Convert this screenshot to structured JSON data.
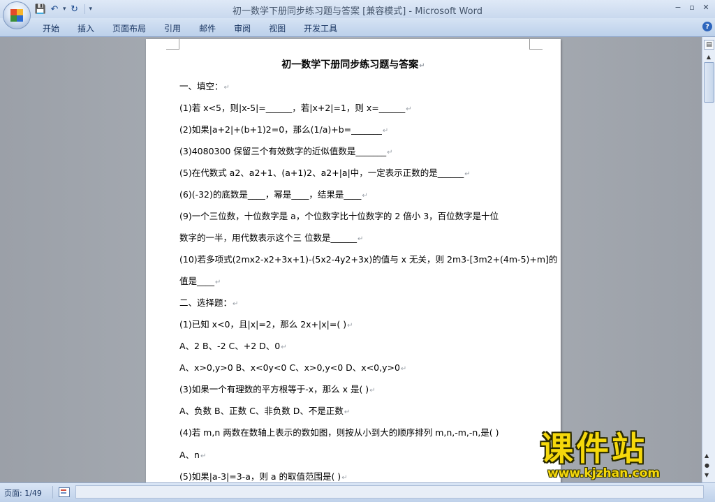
{
  "window": {
    "title": "初一数学下册同步练习题与答案 [兼容模式] - Microsoft Word",
    "controls": [
      "−",
      "▫",
      "✕"
    ]
  },
  "ribbon": {
    "tabs": [
      "开始",
      "插入",
      "页面布局",
      "引用",
      "邮件",
      "审阅",
      "视图",
      "开发工具"
    ]
  },
  "document": {
    "title": "初一数学下册同步练习题与答案",
    "lines": [
      "一、填空：",
      "(1)若 x<5，则|x-5|=______，若|x+2|=1，则 x=______",
      "(2)如果|a+2|+(b+1)2=0，那么(1/a)+b=_______",
      "(3)4080300 保留三个有效数字的近似值数是_______",
      "(5)在代数式 a2、a2+1、(a+1)2、a2+|a|中，一定表示正数的是______",
      "(6)(-32)的底数是____，幂是____，结果是____",
      "(9)一个三位数，十位数字是 a，个位数字比十位数字的 2 倍小 3，百位数字是十位",
      "数字的一半，用代数表示这个三          位数是______",
      "(10)若多项式(2mx2-x2+3x+1)-(5x2-4y2+3x)的值与 x 无关，则 2m3-[3m2+(4m-5)+m]的",
      "值是____",
      "二、选择题：",
      "(1)已知 x<0，且|x|=2，那么 2x+|x|=(        )",
      "A、2      B、-2      C、+2      D、0",
      "A、x>0,y>0      B、x<0y<0      C、x>0,y<0      D、x<0,y>0",
      "(3)如果一个有理数的平方根等于-x，那么 x 是(       )",
      "A、负数      B、正数      C、非负数      D、不是正数",
      "(4)若 m,n 两数在数轴上表示的数如图，则按从小到大的顺序排列 m,n,-m,-n,是(        )",
      "A、n",
      "(5)如果|a-3|=3-a，则 a 的取值范围是(        )"
    ]
  },
  "status": {
    "page": "页面: 1/49"
  },
  "watermark": {
    "title": "课件站",
    "url": "www.kjzhan.com"
  }
}
